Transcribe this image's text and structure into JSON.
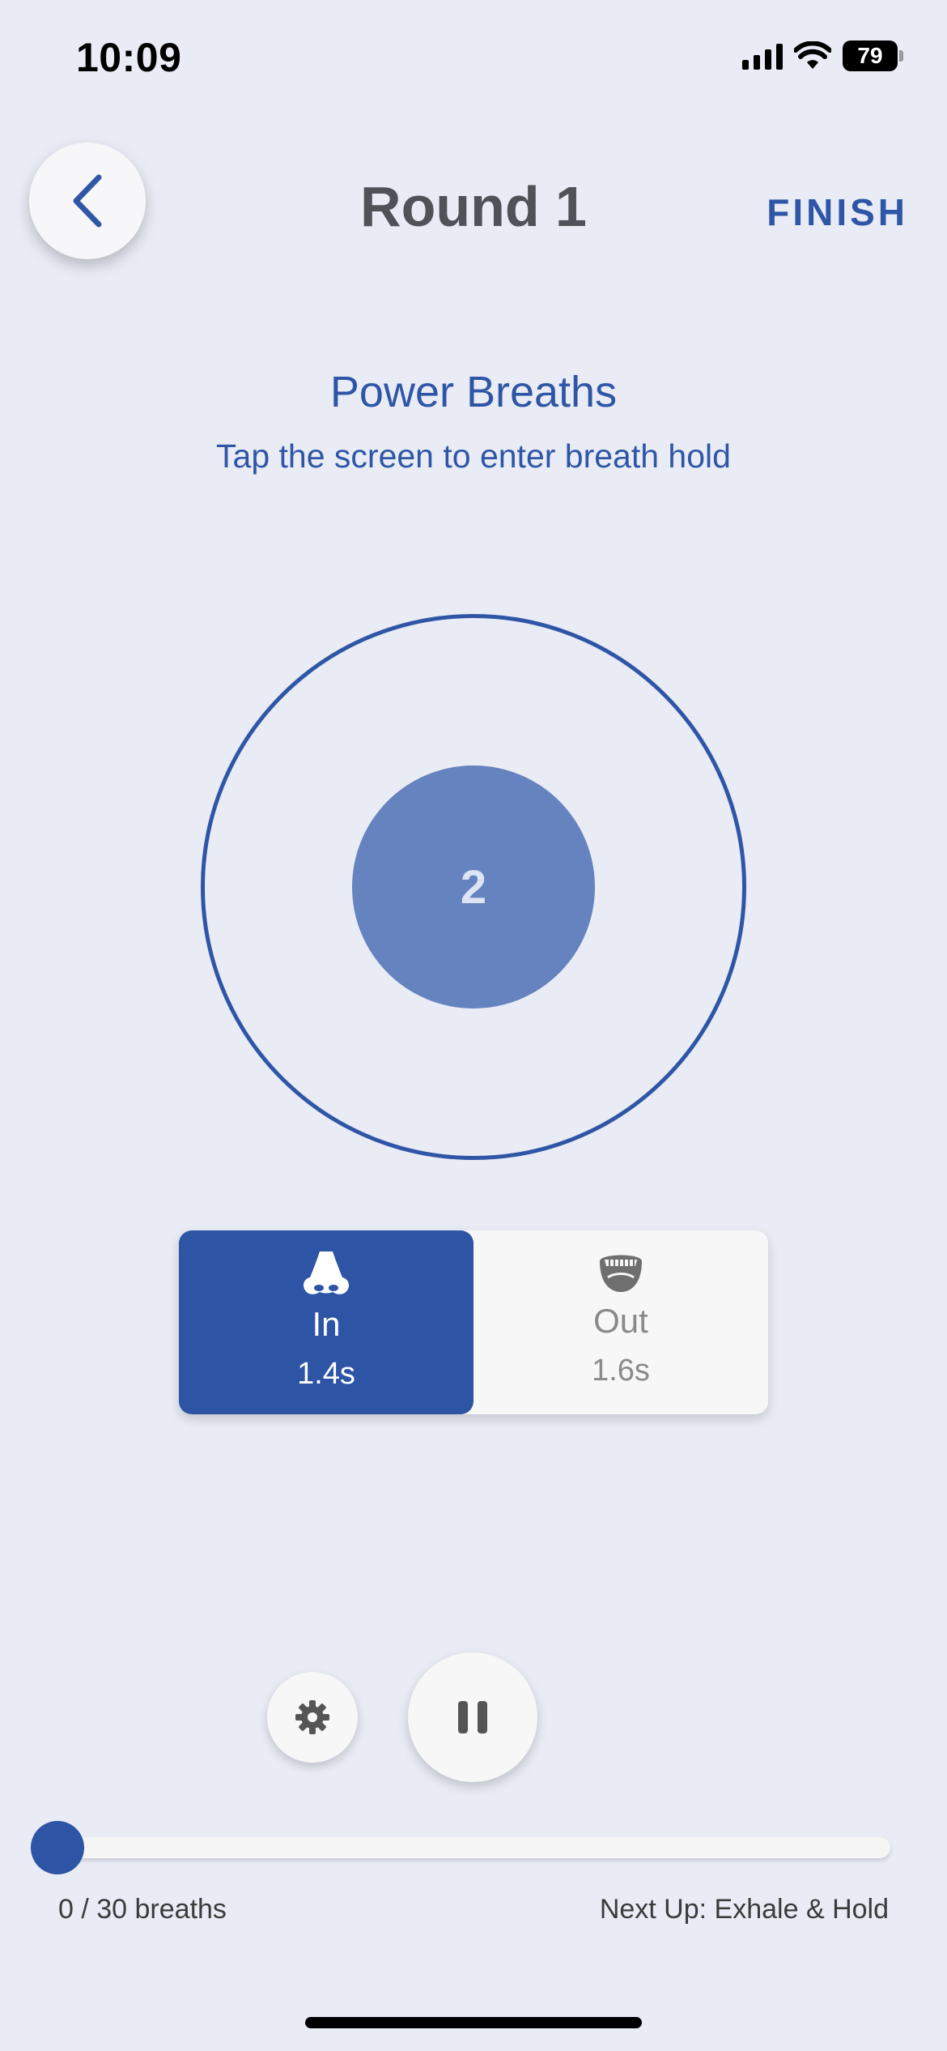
{
  "status_bar": {
    "time": "10:09",
    "battery": "79",
    "icons": [
      "signal-icon",
      "wifi-icon",
      "battery-icon"
    ]
  },
  "header": {
    "title": "Round 1",
    "finish_label": "FINISH",
    "back_icon": "chevron-left-icon"
  },
  "phase": {
    "title": "Power Breaths",
    "subtitle": "Tap the screen to enter breath hold"
  },
  "breath_circle": {
    "count": "2"
  },
  "breath_toggle": {
    "in": {
      "icon": "nose-icon",
      "label": "In",
      "time": "1.4s",
      "active": true
    },
    "out": {
      "icon": "mouth-icon",
      "label": "Out",
      "time": "1.6s",
      "active": false
    }
  },
  "controls": {
    "settings_icon": "gear-icon",
    "pause_icon": "pause-icon"
  },
  "progress": {
    "count_text": "0 / 30 breaths",
    "current": 0,
    "total": 30,
    "next_up": "Next Up: Exhale & Hold"
  },
  "colors": {
    "accent": "#2f56a6",
    "background": "#e9ecf5",
    "inner_circle": "#6583bf"
  }
}
